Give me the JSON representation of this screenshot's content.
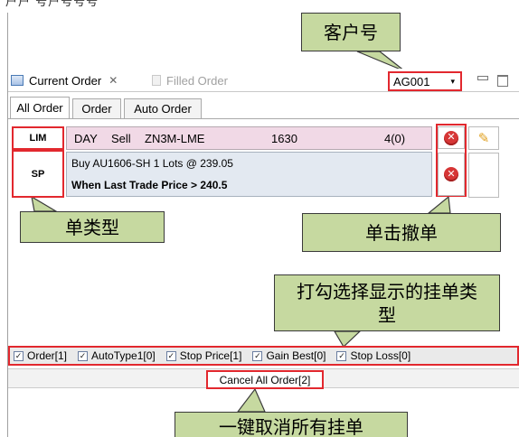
{
  "top_strip_text": "户户 号户号号号",
  "callouts": {
    "account": "客户号",
    "order_type": "单类型",
    "click_cancel": "单击撤单",
    "check_select": "打勾选择显示的挂单类型",
    "cancel_all": "一键取消所有挂单"
  },
  "view_tabs": [
    {
      "label": "Current Order",
      "active": true,
      "close": "✕"
    },
    {
      "label": "Filled Order",
      "active": false
    }
  ],
  "account": {
    "value": "AG001",
    "caret": "▾"
  },
  "inner_tabs": [
    "All Order",
    "Order",
    "Auto Order"
  ],
  "orders": [
    {
      "type": "LIM",
      "validity": "DAY",
      "side": "Sell",
      "contract": "ZN3M-LME",
      "price": "1630",
      "qty": "4(0)"
    },
    {
      "type": "SP",
      "line1": "Buy AU1606-SH 1 Lots @ 239.05",
      "line2": "When Last Trade Price > 240.5"
    }
  ],
  "cancel_icon_glyph": "✕",
  "edit_icon_glyph": "✎",
  "filters": [
    {
      "label": "Order[1]",
      "checked": true
    },
    {
      "label": "AutoType1[0]",
      "checked": true
    },
    {
      "label": "Stop Price[1]",
      "checked": true
    },
    {
      "label": "Gain Best[0]",
      "checked": true
    },
    {
      "label": "Stop Loss[0]",
      "checked": true
    }
  ],
  "check_glyph": "✓",
  "cancel_all_label": "Cancel All Order[2]",
  "colors": {
    "highlight_red": "#e2282e",
    "callout_green": "#c6d9a0",
    "row_pink": "#f1d9e6",
    "row_blue": "#e3e9f1"
  }
}
